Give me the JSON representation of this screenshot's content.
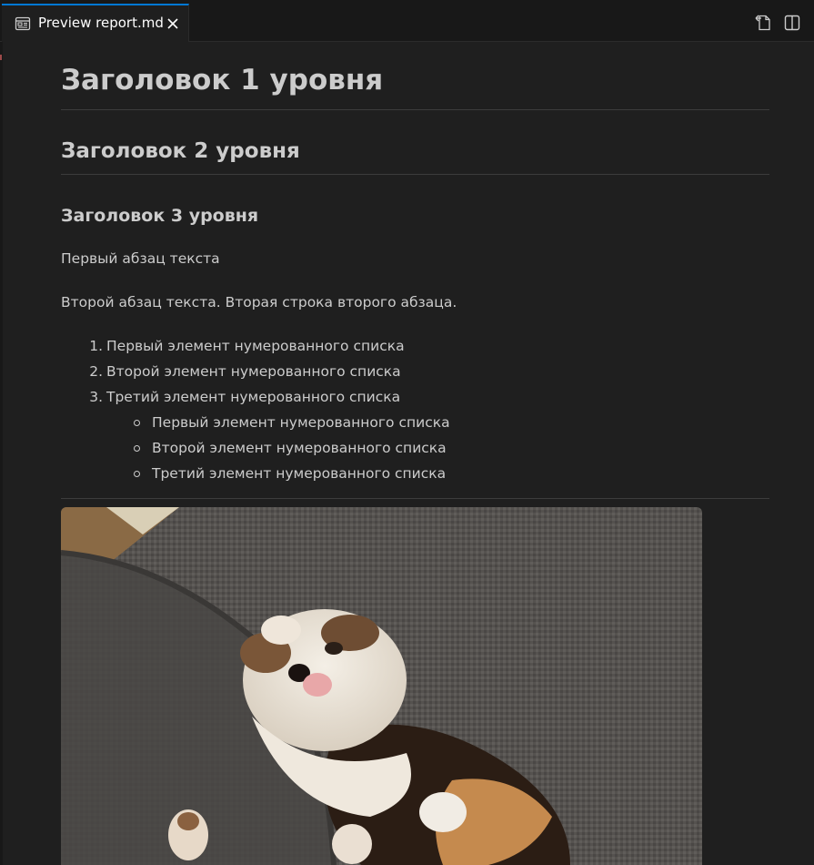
{
  "tab": {
    "title": "Preview report.md",
    "icon": "preview-icon",
    "close_icon": "close-icon"
  },
  "toolbar": {
    "open_source_icon": "open-source-icon",
    "split_editor_icon": "split-editor-icon"
  },
  "document": {
    "h1": "Заголовок 1 уровня",
    "h2": "Заголовок 2 уровня",
    "h3": "Заголовок 3 уровня",
    "paragraph1": "Первый абзац текста",
    "paragraph2": "Второй абзац текста. Вторая строка второго абзаца.",
    "ordered_list": [
      {
        "num": "1.",
        "text": "Первый элемент нумерованного списка"
      },
      {
        "num": "2.",
        "text": "Второй элемент нумерованного списка"
      },
      {
        "num": "3.",
        "text": "Третий элемент нумерованного списка"
      }
    ],
    "nested_list": [
      {
        "text": "Первый элемент нумерованного списка"
      },
      {
        "text": "Второй элемент нумерованного списка"
      },
      {
        "text": "Третий элемент нумерованного списка"
      }
    ],
    "image": {
      "subject": "ferret-photo"
    }
  },
  "colors": {
    "background": "#1f1f1f",
    "tabbar": "#181818",
    "active_tab_border": "#0078d4",
    "text": "#cccccc",
    "rule": "#3c3c3c"
  }
}
